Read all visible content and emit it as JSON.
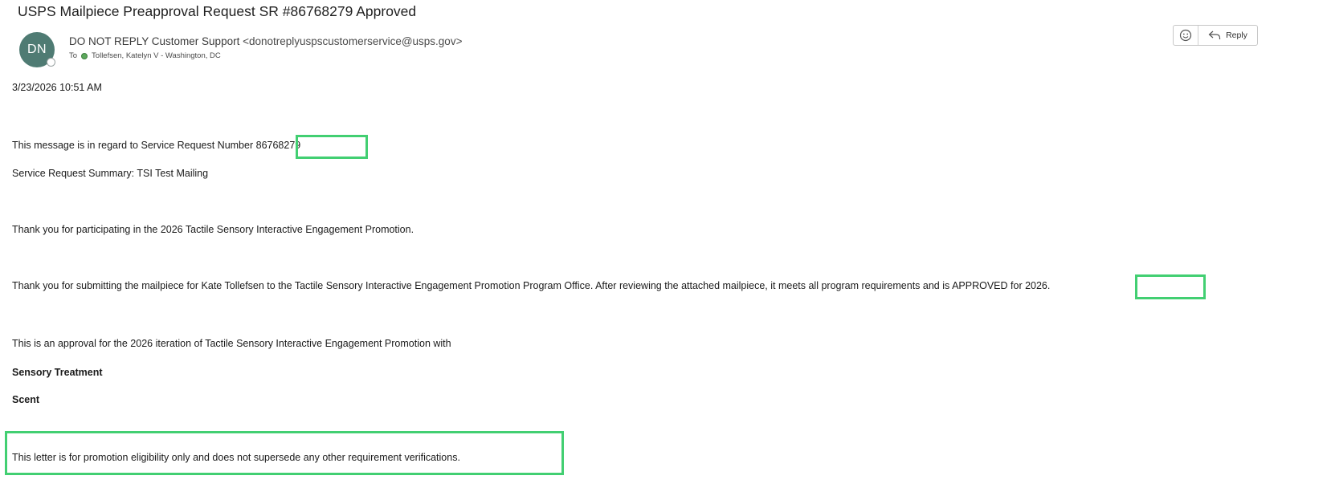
{
  "subject": "USPS Mailpiece Preapproval Request SR #86768279 Approved",
  "sender": {
    "initials": "DN",
    "name": "DO NOT REPLY Customer Support",
    "email": "<donotreplyuspscustomerservice@usps.gov>",
    "to_label": "To",
    "recipient": "Tollefsen, Katelyn V - Washington, DC"
  },
  "actions": {
    "reply_label": "Reply"
  },
  "email_body": {
    "timestamp": "3/23/2026 10:51 AM",
    "sr_line_prefix": "This message is in regard to Service Request Number",
    "sr_number": "86768279",
    "summary": "Service Request Summary: TSI Test Mailing",
    "thanks_line": "Thank you for participating in the 2026 Tactile Sensory Interactive Engagement Promotion.",
    "submission_prefix": "Thank you for submitting the mailpiece for Kate Tollefsen to the Tactile Sensory Interactive Engagement Promotion Program Office. After reviewing the attached mailpiece, it meets all program requirements and is",
    "approved_word": "APPROVED",
    "submission_suffix": "for 2026.",
    "approval_line": "This is an approval for the 2026 iteration of Tactile Sensory Interactive Engagement Promotion with",
    "treatment_label": "Sensory Treatment",
    "scent_label": "Scent",
    "disclaimer": "This letter is for promotion eligibility only and does not supersede any other requirement verifications."
  },
  "colors": {
    "highlight": "#42cf72",
    "avatar_bg": "#4f7b73"
  }
}
